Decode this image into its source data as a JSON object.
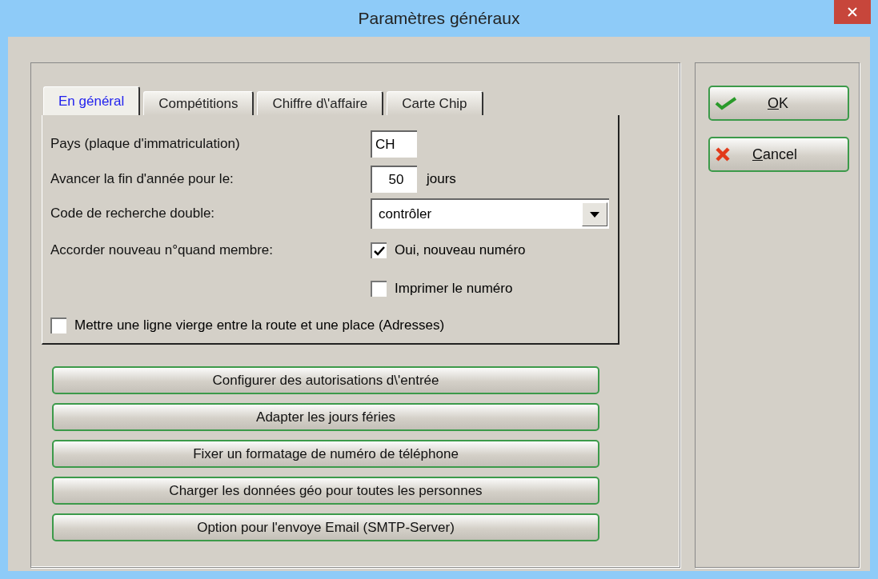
{
  "window": {
    "title": "Paramètres généraux"
  },
  "tabs": [
    {
      "label": "En général",
      "selected": true
    },
    {
      "label": "Compétitions",
      "selected": false
    },
    {
      "label": "Chiffre d\\'affaire",
      "selected": false
    },
    {
      "label": "Carte Chip",
      "selected": false
    }
  ],
  "fields": [
    {
      "kind": "text",
      "label": "Pays (plaque d'immatriculation)",
      "value": "CH"
    },
    {
      "kind": "number",
      "label": "Avancer la fin d'année pour le:",
      "value": "50",
      "unit": "jours"
    },
    {
      "kind": "select",
      "label": "Code de recherche double:",
      "value": "contrôler"
    },
    {
      "kind": "checks",
      "label": "Accorder nouveau n°quand membre:",
      "options": [
        {
          "label": "Oui, nouveau numéro",
          "checked": true
        },
        {
          "label": "Imprimer le numéro",
          "checked": false
        }
      ]
    }
  ],
  "blank_line_option": {
    "label": "Mettre une ligne vierge entre la route et une place (Adresses)",
    "checked": false
  },
  "action_buttons": [
    "Configurer des autorisations d\\'entrée",
    "Adapter les jours féries",
    "Fixer un formatage de numéro de téléphone",
    "Charger les données géo pour toutes les personnes",
    "Option pour l'envoye Email (SMTP-Server)"
  ],
  "dialog_buttons": [
    {
      "kind": "ok",
      "label": "OK",
      "first_letter_underlined": true
    },
    {
      "kind": "cancel",
      "label": "Cancel",
      "first_letter_underlined": true
    }
  ]
}
